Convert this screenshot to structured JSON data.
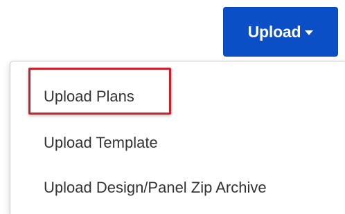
{
  "upload_button": {
    "label": "Upload",
    "caret_icon": "caret-down-icon",
    "color": "#0b4fc7"
  },
  "dropdown": {
    "items": [
      {
        "label": "Upload Plans",
        "highlighted": true
      },
      {
        "label": "Upload Template",
        "highlighted": false
      },
      {
        "label": "Upload Design/Panel Zip Archive",
        "highlighted": false
      }
    ],
    "highlight_color": "#cf1f2a"
  }
}
